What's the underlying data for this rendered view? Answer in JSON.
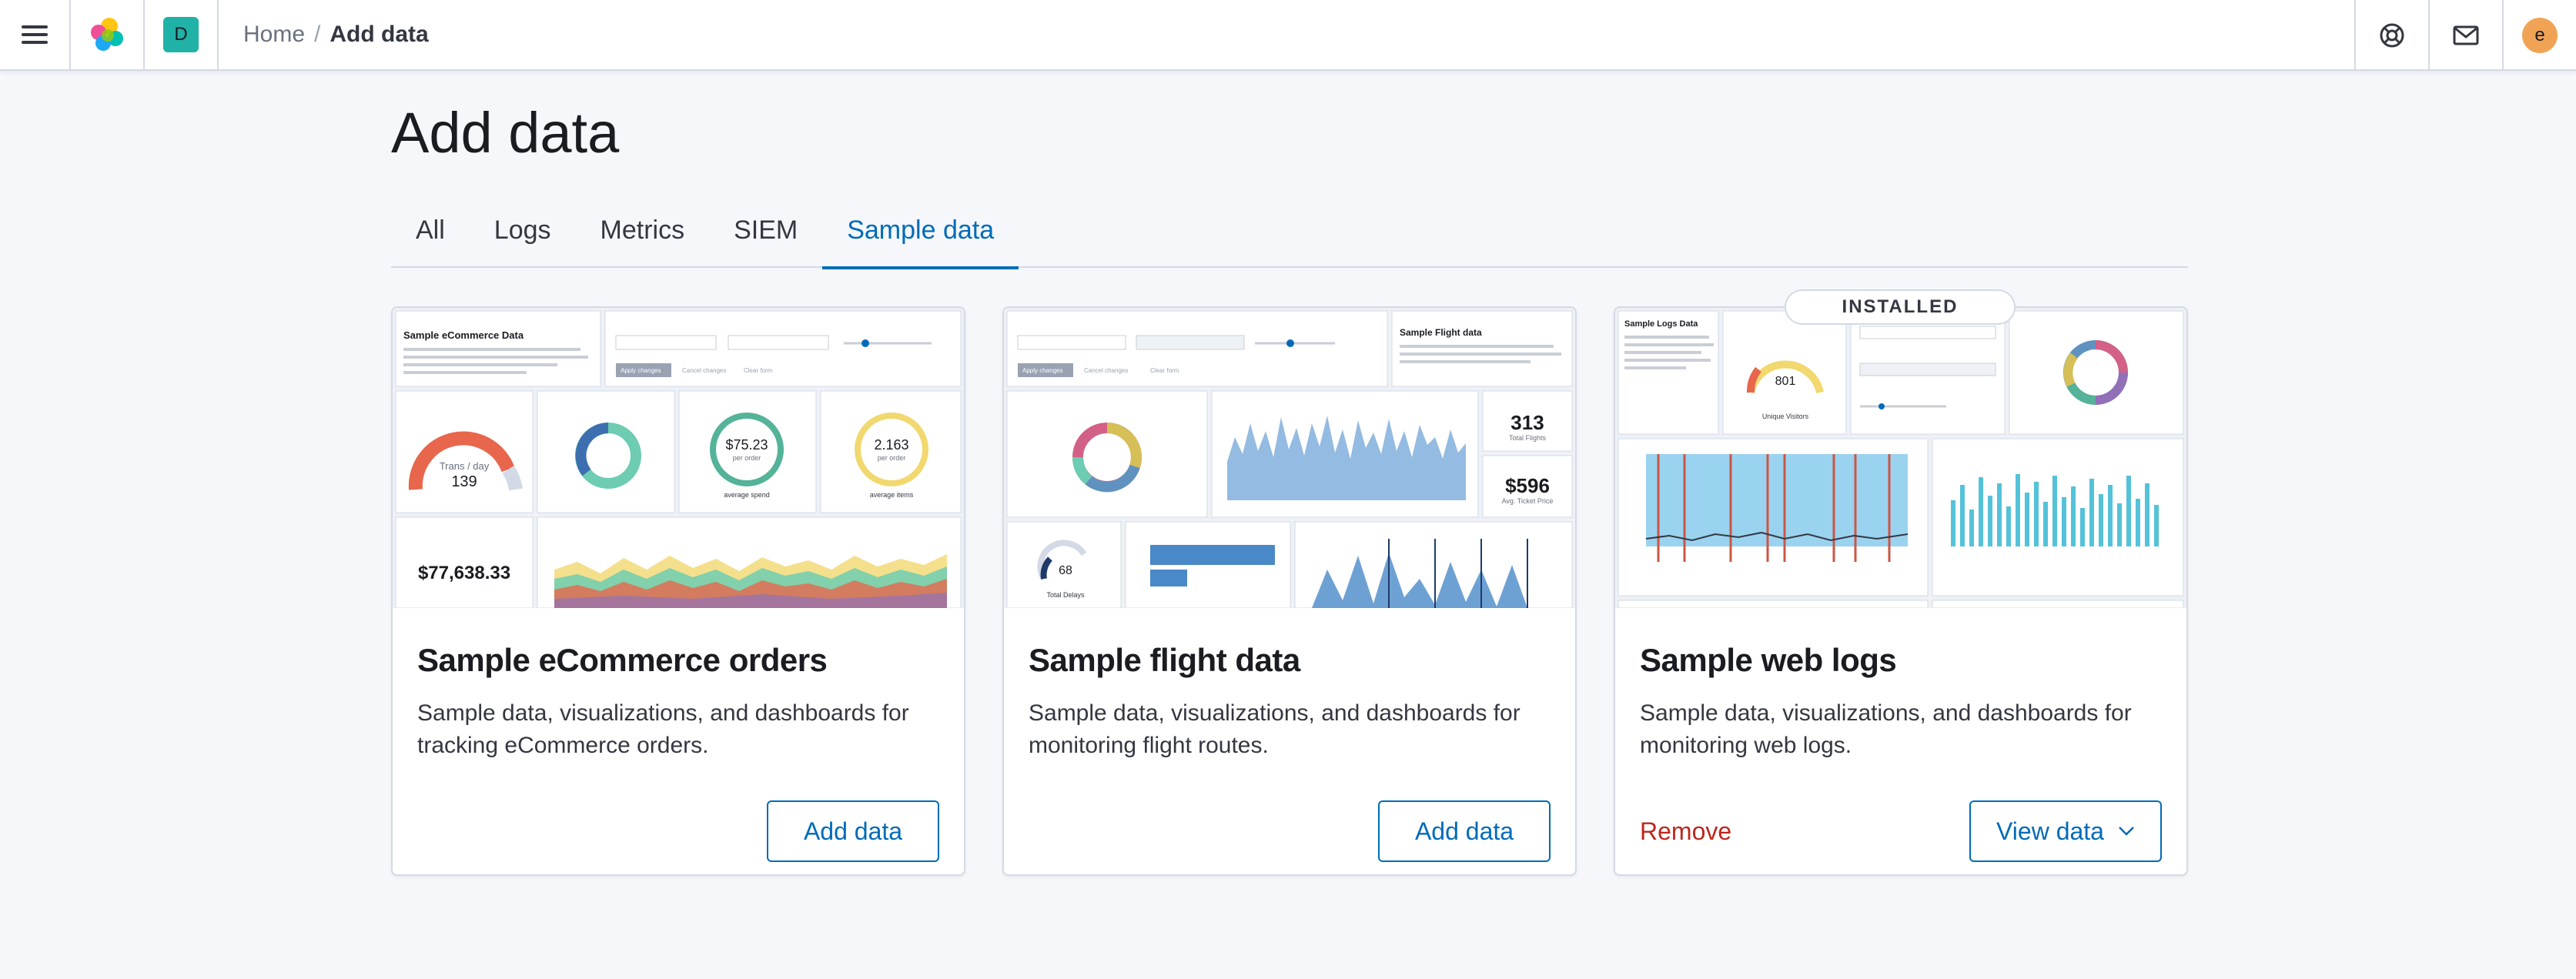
{
  "header": {
    "menu_icon": "hamburger-icon",
    "logo_icon": "elastic-logo-icon",
    "space_initial": "D",
    "breadcrumb_home": "Home",
    "breadcrumb_sep": "/",
    "breadcrumb_current": "Add data",
    "help_icon": "help-lifebuoy-icon",
    "news_icon": "mail-icon",
    "user_initial": "e"
  },
  "page": {
    "title": "Add data",
    "tabs": [
      {
        "label": "All",
        "selected": false
      },
      {
        "label": "Logs",
        "selected": false
      },
      {
        "label": "Metrics",
        "selected": false
      },
      {
        "label": "SIEM",
        "selected": false
      },
      {
        "label": "Sample data",
        "selected": true
      }
    ]
  },
  "cards": [
    {
      "title": "Sample eCommerce orders",
      "description": "Sample data, visualizations, and dashboards for tracking eCommerce orders.",
      "primary_action": "Add data",
      "preview": {
        "heading": "Sample eCommerce Data",
        "gauge_label": "Trans / day",
        "gauge_value": "139",
        "avg_spend": "$75.23",
        "avg_spend_sub": "per order",
        "avg_spend_caption": "average spend",
        "avg_items": "2.163",
        "avg_items_sub": "per order",
        "avg_items_caption": "average items",
        "total_revenue": "$77,638.33",
        "apply_label": "Apply changes",
        "cancel_label": "Cancel changes",
        "clear_label": "Clear form"
      }
    },
    {
      "title": "Sample flight data",
      "description": "Sample data, visualizations, and dashboards for monitoring flight routes.",
      "primary_action": "Add data",
      "preview": {
        "heading": "Sample Flight data",
        "total_flights": "313",
        "total_flights_caption": "Total Flights",
        "avg_price": "$596",
        "avg_price_caption": "Avg. Ticket Price",
        "delays": "68",
        "delays_caption": "Total Delays",
        "apply_label": "Apply changes",
        "cancel_label": "Cancel changes",
        "clear_label": "Clear form"
      }
    },
    {
      "title": "Sample web logs",
      "description": "Sample data, visualizations, and dashboards for monitoring web logs.",
      "badge": "INSTALLED",
      "remove_action": "Remove",
      "primary_action": "View data",
      "preview": {
        "heading": "Sample Logs Data",
        "visitors": "801",
        "visitors_caption": "Unique Visitors"
      }
    }
  ],
  "colors": {
    "accent": "#006bb8",
    "danger": "#bd271e",
    "space_badge": "#20b2a6",
    "avatar": "#f1a355"
  }
}
